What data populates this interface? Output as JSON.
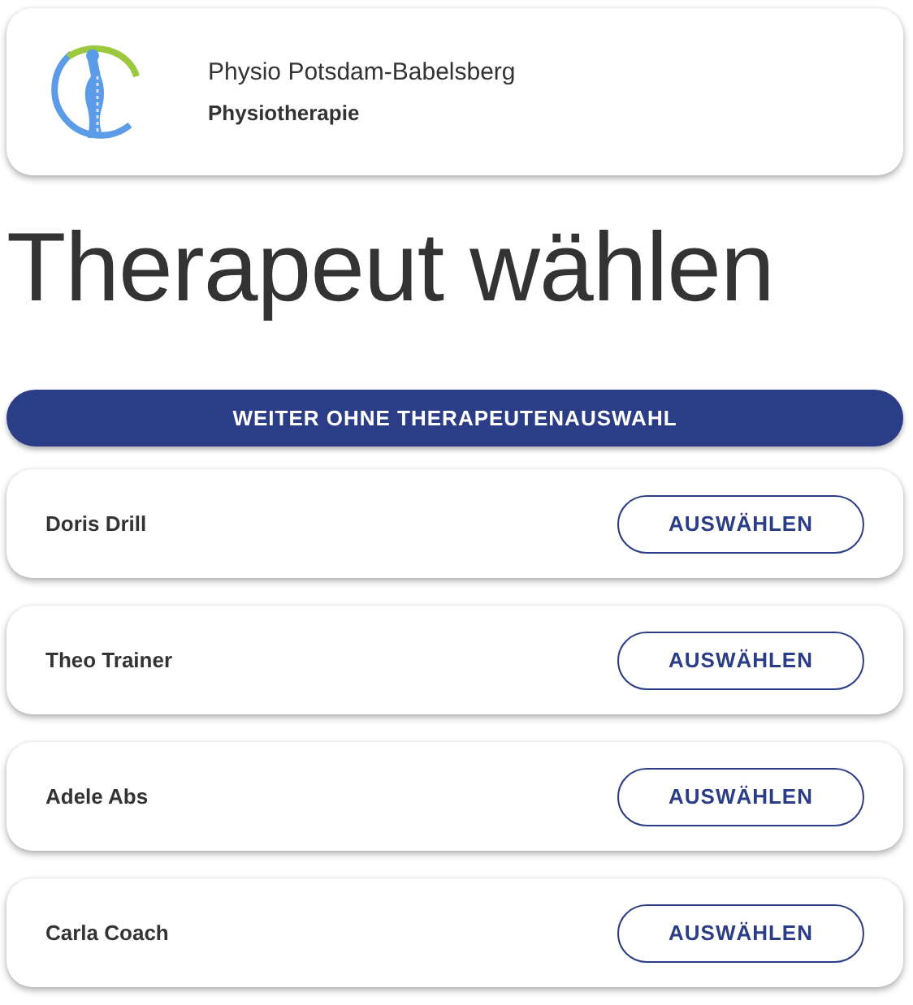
{
  "practice": {
    "name": "Physio Potsdam-Babelsberg",
    "category": "Physiotherapie"
  },
  "title": "Therapeut wählen",
  "skip_button": "WEITER OHNE THERAPEUTENAUSWAHL",
  "therapists": [
    {
      "name": "Doris Drill",
      "button": "AUSWÄHLEN"
    },
    {
      "name": "Theo Trainer",
      "button": "AUSWÄHLEN"
    },
    {
      "name": "Adele Abs",
      "button": "AUSWÄHLEN"
    },
    {
      "name": "Carla Coach",
      "button": "AUSWÄHLEN"
    }
  ]
}
